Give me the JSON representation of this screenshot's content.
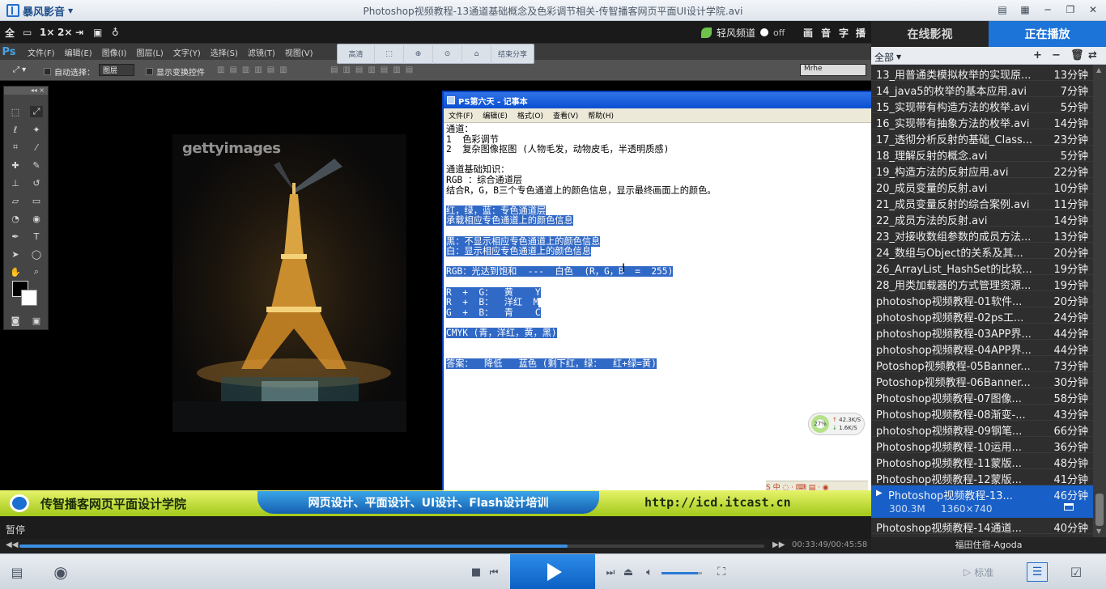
{
  "window": {
    "app_name": "暴风影音",
    "title": "Photoshop视频教程-13通道基础概念及色彩调节相关-传智播客网页平面UI设计学院.avi"
  },
  "player_toolbar": {
    "items": [
      "全",
      "1×",
      "2×"
    ],
    "lightwind_label": "轻风频道",
    "toggle_state": "off",
    "right_icons": [
      "画",
      "音",
      "字",
      "播"
    ]
  },
  "overlay_bar": {
    "items": [
      "高清",
      "结束分享"
    ]
  },
  "photoshop": {
    "logo": "Ps",
    "menus": [
      "文件(F)",
      "编辑(E)",
      "图像(I)",
      "图层(L)",
      "文字(Y)",
      "选择(S)",
      "滤镜(T)",
      "视图(V)"
    ],
    "auto_select_label": "自动选择：",
    "layer_select": "图层",
    "transform_label": "显示变换控件",
    "font_value": "Mrhe",
    "watermark": "gettyimages"
  },
  "notepad": {
    "title": "PS第六天 - 记事本",
    "menus": [
      "文件(F)",
      "编辑(E)",
      "格式(O)",
      "查看(V)",
      "帮助(H)"
    ],
    "lines": [
      {
        "text": "通道：",
        "sel": false
      },
      {
        "text": "1  色彩调节",
        "sel": false
      },
      {
        "text": "2  复杂图像抠图 (人物毛发，动物皮毛，半透明质感)",
        "sel": false
      },
      {
        "text": "",
        "sel": false
      },
      {
        "text": "通道基础知识：",
        "sel": false
      },
      {
        "text": "RGB ：综合通道层",
        "sel": false
      },
      {
        "text": "结合R，G，B三个专色通道上的颜色信息，显示最终画面上的颜色。",
        "sel": false
      },
      {
        "text": "",
        "sel": false
      },
      {
        "text": "红，绿，蓝：专色通道层",
        "sel": true
      },
      {
        "text": "承载相应专色通道上的颜色信息",
        "sel": true
      },
      {
        "text": "",
        "sel": false
      },
      {
        "text": "黑：不显示相应专色通道上的颜色信息",
        "sel": true
      },
      {
        "text": "白：显示相应专色通道上的颜色信息",
        "sel": true
      },
      {
        "text": "",
        "sel": false
      },
      {
        "text": "RGB：光达到饱和  ---  白色  (R，G，B  =  255)",
        "sel": true
      },
      {
        "text": "",
        "sel": false
      },
      {
        "text": "R  +  G：  黄    Y",
        "sel": true
      },
      {
        "text": "R  +  B：  洋红  M",
        "sel": true
      },
      {
        "text": "G  +  B：  青    C",
        "sel": true
      },
      {
        "text": "",
        "sel": false
      },
      {
        "text": "CMYK (青，洋红，黄，黑)",
        "sel": true
      },
      {
        "text": "",
        "sel": false
      },
      {
        "text": "",
        "sel": false
      },
      {
        "text": "答案：  降低   蓝色 (剩下红，绿：  红+绿=黄)",
        "sel": true
      }
    ]
  },
  "net_widget": {
    "percent": "27%",
    "up": "42.3K/S",
    "down": "1.6K/S"
  },
  "banner": {
    "name": "传智播客网页平面设计学院",
    "slogan": "网页设计、平面设计、UI设计、Flash设计培训",
    "url": "http://icd.itcast.cn"
  },
  "status": {
    "state": "暂停",
    "time": "00:33:49/00:45:58",
    "progress": 0.736
  },
  "controls": {
    "standard_label": "标准",
    "volume": 0.9
  },
  "panel": {
    "tabs": [
      "在线影视",
      "正在播放"
    ],
    "all_label": "全部",
    "items": [
      {
        "name": "13_用普通类模拟枚举的实现原...",
        "dur": "13分钟"
      },
      {
        "name": "14_java5的枚举的基本应用.avi",
        "dur": "7分钟"
      },
      {
        "name": "15_实现带有构造方法的枚举.avi",
        "dur": "5分钟"
      },
      {
        "name": "16_实现带有抽象方法的枚举.avi",
        "dur": "14分钟"
      },
      {
        "name": "17_透彻分析反射的基础_Class...",
        "dur": "23分钟"
      },
      {
        "name": "18_理解反射的概念.avi",
        "dur": "5分钟"
      },
      {
        "name": "19_构造方法的反射应用.avi",
        "dur": "22分钟"
      },
      {
        "name": "20_成员变量的反射.avi",
        "dur": "10分钟"
      },
      {
        "name": "21_成员变量反射的综合案例.avi",
        "dur": "11分钟"
      },
      {
        "name": "22_成员方法的反射.avi",
        "dur": "14分钟"
      },
      {
        "name": "23_对接收数组参数的成员方法...",
        "dur": "13分钟"
      },
      {
        "name": "24_数组与Object的关系及其...",
        "dur": "20分钟"
      },
      {
        "name": "26_ArrayList_HashSet的比较...",
        "dur": "19分钟"
      },
      {
        "name": "28_用类加载器的方式管理资源...",
        "dur": "19分钟"
      },
      {
        "name": "photoshop视频教程-01软件...",
        "dur": "20分钟"
      },
      {
        "name": "photoshop视频教程-02ps工...",
        "dur": "24分钟"
      },
      {
        "name": "photoshop视频教程-03APP界...",
        "dur": "44分钟"
      },
      {
        "name": "photoshop视频教程-04APP界...",
        "dur": "44分钟"
      },
      {
        "name": "Potoshop视频教程-05Banner...",
        "dur": "73分钟"
      },
      {
        "name": "Potoshop视频教程-06Banner...",
        "dur": "30分钟"
      },
      {
        "name": "Photoshop视频教程-07图像...",
        "dur": "58分钟"
      },
      {
        "name": "Photoshop视频教程-08渐变-...",
        "dur": "43分钟"
      },
      {
        "name": "photoshop视频教程-09钢笔...",
        "dur": "66分钟"
      },
      {
        "name": "Photoshop视频教程-10运用...",
        "dur": "36分钟"
      },
      {
        "name": "Photoshop视频教程-11蒙版...",
        "dur": "48分钟"
      },
      {
        "name": "Photoshop视频教程-12蒙版...",
        "dur": "41分钟"
      }
    ],
    "current": {
      "name": "Photoshop视频教程-13...",
      "dur": "46分钟",
      "size": "300.3M",
      "resolution": "1360×740"
    },
    "next": {
      "name": "Photoshop视频教程-14通道...",
      "dur": "40分钟"
    },
    "footer": "福田住宿-Agoda"
  }
}
